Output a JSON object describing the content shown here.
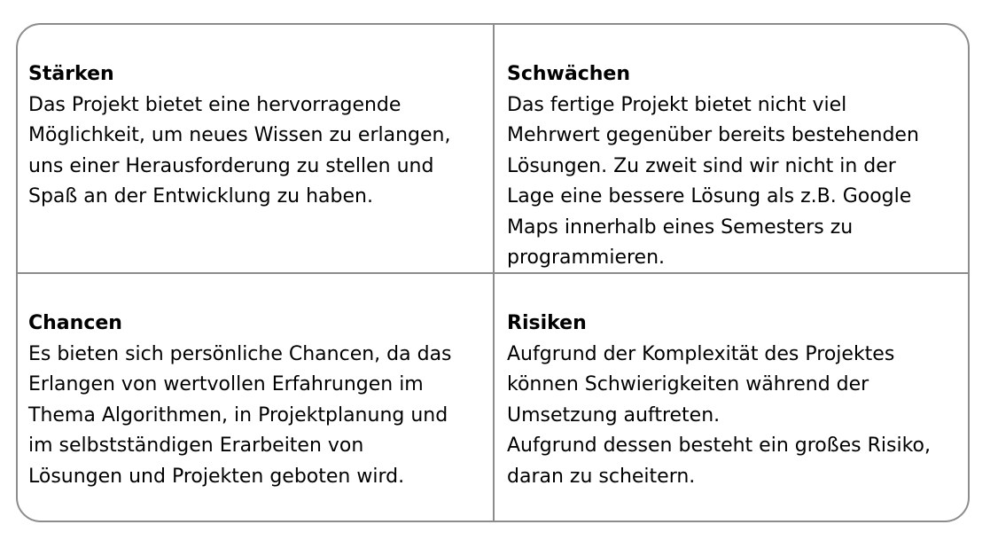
{
  "swot": {
    "strengths": {
      "heading": "Stärken",
      "lines": [
        "Das Projekt bietet eine hervorragende",
        "Möglichkeit, um neues Wissen zu erlangen,",
        "uns einer Herausforderung zu stellen und",
        "Spaß an der Entwicklung zu haben."
      ]
    },
    "weaknesses": {
      "heading": "Schwächen",
      "lines": [
        "Das fertige Projekt bietet nicht viel",
        "Mehrwert gegenüber bereits bestehenden",
        "Lösungen. Zu zweit sind wir nicht in der",
        "Lage eine bessere Lösung als z.B. Google",
        "Maps innerhalb eines Semesters zu",
        "programmieren."
      ]
    },
    "opportunities": {
      "heading": "Chancen",
      "lines": [
        "Es bieten sich persönliche Chancen, da das",
        "Erlangen von wertvollen Erfahrungen im",
        "Thema Algorithmen, in Projektplanung und",
        "im selbstständigen Erarbeiten von",
        "Lösungen und Projekten geboten wird."
      ]
    },
    "threats": {
      "heading": "Risiken",
      "lines": [
        "Aufgrund der Komplexität des Projektes",
        "können Schwierigkeiten während der",
        "Umsetzung auftreten.",
        "Aufgrund dessen besteht ein großes Risiko,",
        "daran zu scheitern."
      ]
    }
  }
}
